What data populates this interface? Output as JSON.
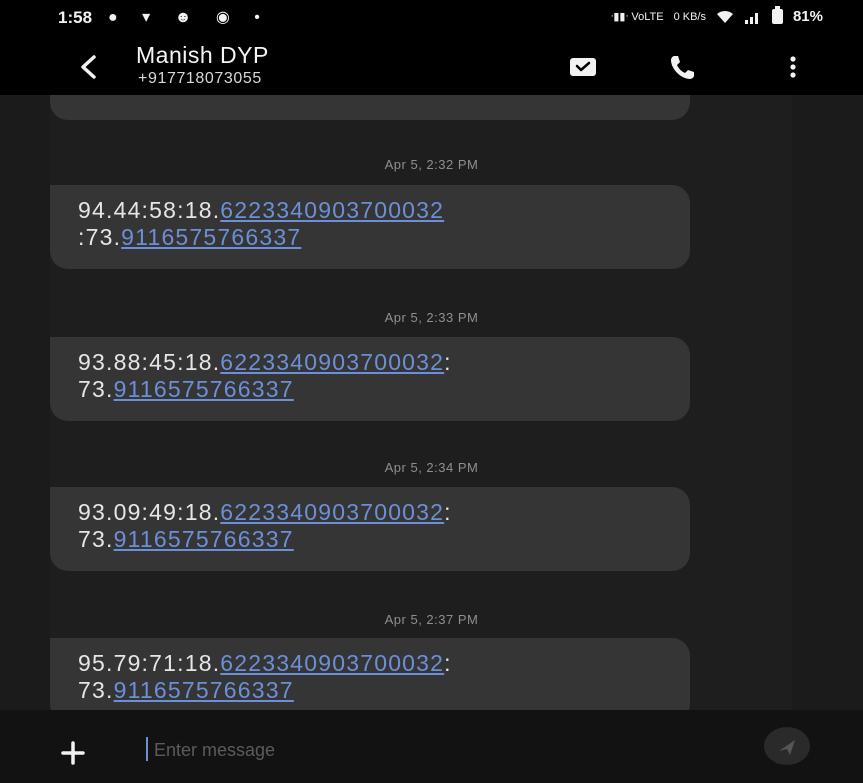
{
  "status_bar": {
    "time": "1:58",
    "left_icons": "● ▾ ☻ ◉ •",
    "net_info": "ᐧ▮▮ᐧ  VoLTE",
    "speed": "0 KB/s",
    "battery_percent": "81%"
  },
  "header": {
    "contact_name": "Manish DYP",
    "contact_number": "+917718073055"
  },
  "messages": [
    {
      "timestamp": "Apr 5, 2:32 PM",
      "prefix": "94.44:58:18.",
      "link1": "6223340903700032",
      "mid": "\n:73.",
      "link2": "9116575766337",
      "tail": ""
    },
    {
      "timestamp": "Apr 5, 2:33 PM",
      "prefix": "93.88:45:18.",
      "link1": "6223340903700032",
      "mid": ":\n73.",
      "link2": "9116575766337",
      "tail": ""
    },
    {
      "timestamp": "Apr 5, 2:34 PM",
      "prefix": "93.09:49:18.",
      "link1": "6223340903700032",
      "mid": ":\n73.",
      "link2": "9116575766337",
      "tail": ""
    },
    {
      "timestamp": "Apr 5, 2:37 PM",
      "prefix": "95.79:71:18.",
      "link1": "6223340903700032",
      "mid": ":\n73.",
      "link2": "9116575766337",
      "tail": ""
    }
  ],
  "compose": {
    "placeholder": "Enter message",
    "value": ""
  },
  "colors": {
    "background": "#1e1e1e",
    "bubble": "#353535",
    "link": "#6d8fd8",
    "timestamp": "#8f8f8f"
  }
}
